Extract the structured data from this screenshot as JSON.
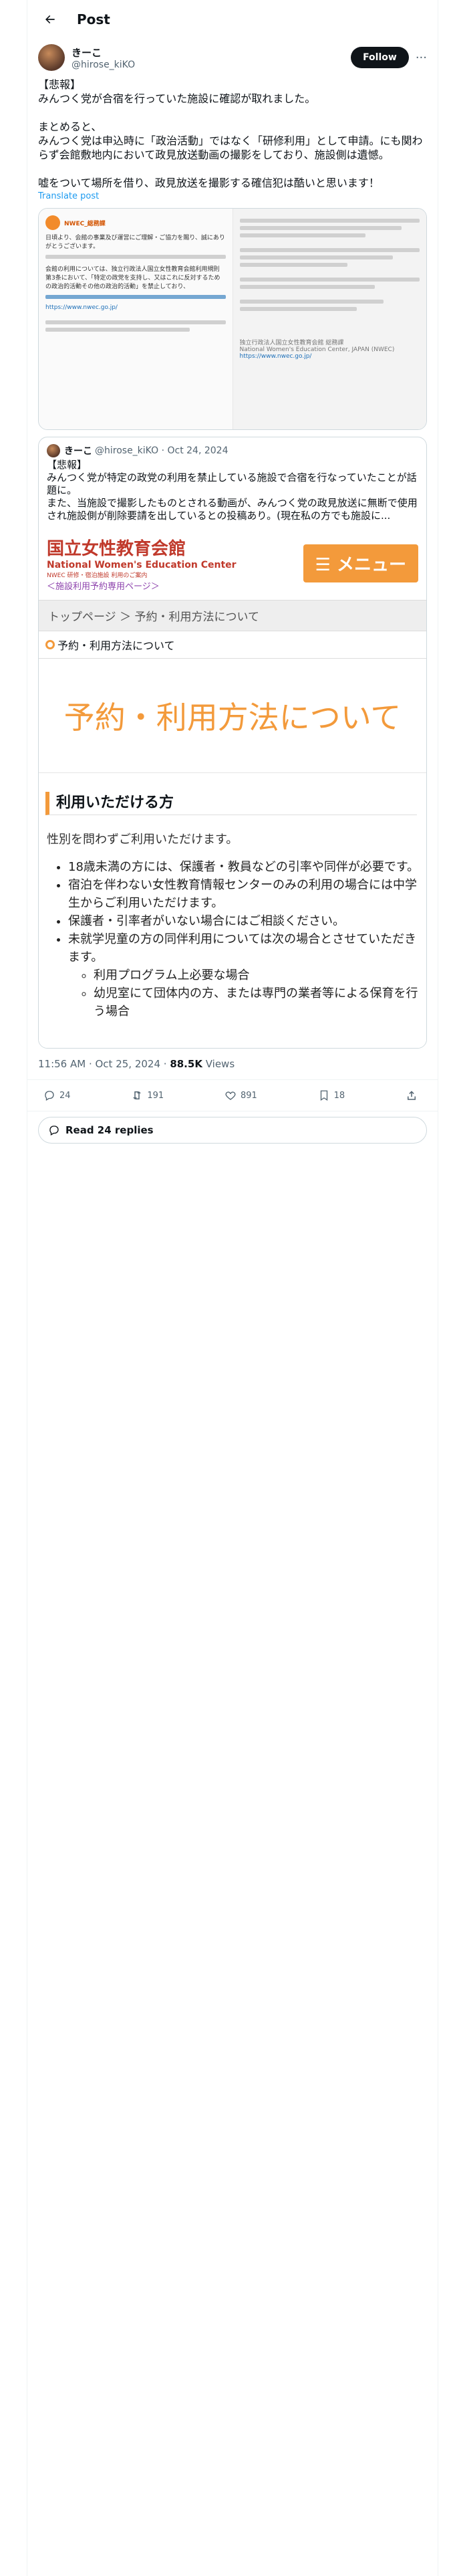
{
  "header": {
    "title": "Post"
  },
  "post": {
    "display_name": "きーこ",
    "handle": "@hirose_kiKO",
    "follow_label": "Follow",
    "text": "【悲報】\nみんつく党が合宿を行っていた施設に確認が取れました。\n\nまとめると、\nみんつく党は申込時に「政治活動」ではなく「研修利用」として申請。にも関わらず会館敷地内において政見放送動画の撮影をしており、施設側は遺憾。\n\n嘘をついて場所を借り、政見放送を撮影する確信犯は酷いと思います！",
    "translate": "Translate post",
    "timestamp": "11:56 AM · Oct 25, 2024 · ",
    "views_count": "88.5K",
    "views_label": " Views"
  },
  "image_left": {
    "account": "NWEC_総務課",
    "body1": "日頃より、会館の事業及び運営にご理解・ご協力を賜り、誠にありがとうございます。",
    "body2": "会館の利用については、独立行政法人国立女性教育会館利用規則第3条において、「特定の政党を支持し、又はこれに反対するための政治的活動その他の政治的活動」を禁止しており、",
    "link": "https://www.nwec.go.jp/"
  },
  "image_right": {
    "footer": "独立行政法人国立女性教育会館 総務課",
    "footer2": "National Women's Education Center, JAPAN (NWEC)",
    "link": "https://www.nwec.go.jp/"
  },
  "quote": {
    "display_name": "きーこ",
    "handle": "@hirose_kiKO",
    "date": "Oct 24, 2024",
    "text": "【悲報】\nみんつく党が特定の政党の利用を禁止している施設で合宿を行なっていたことが話題に。\nまた、当施設で撮影したものとされる動画が、みんつく党の政見放送に無断で使用され施設側が削除要請を出しているとの投稿あり。(現在私の方でも施設に..."
  },
  "site": {
    "logo_main": "国立女性教育会館",
    "logo_en": "National Women's Education Center",
    "logo_small": "NWEC 研修・宿泊施設 利用のご案内",
    "logo_sub": "＜施設利用予約専用ページ＞",
    "menu": "☰ メニュー",
    "breadcrumb": "トップページ ＞ 予約・利用方法について",
    "section_small": "予約・利用方法について",
    "hero": "予約・利用方法について",
    "heading": "利用いただける方",
    "lead": "性別を問わずご利用いただけます。",
    "items": [
      "18歳未満の方には、保護者・教員などの引率や同伴が必要です。",
      "宿泊を伴わない女性教育情報センターのみの利用の場合には中学生からご利用いただけます。",
      "保護者・引率者がいない場合にはご相談ください。",
      "未就学児童の方の同伴利用については次の場合とさせていただきます。"
    ],
    "sub_items": [
      "利用プログラム上必要な場合",
      "幼児室にて団体内の方、または専門の業者等による保育を行う場合"
    ]
  },
  "actions": {
    "replies": "24",
    "reposts": "191",
    "likes": "891",
    "bookmarks": "18"
  },
  "read_replies": "Read 24 replies"
}
